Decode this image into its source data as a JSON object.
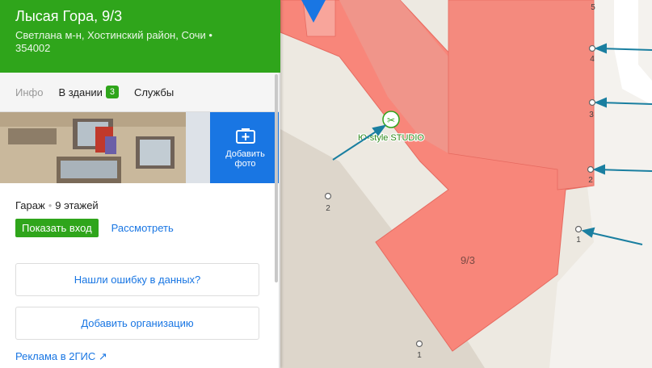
{
  "place": {
    "title": "Лысая Гора, 9/3",
    "address": "Светлана м-н, Хостинский район, Сочи • 354002"
  },
  "tabs": [
    {
      "label": "Инфо",
      "active": true
    },
    {
      "label": "В здании",
      "badge": "3"
    },
    {
      "label": "Службы"
    }
  ],
  "photos": {
    "add_label_line1": "Добавить",
    "add_label_line2": "фото"
  },
  "building": {
    "type": "Гараж",
    "floors": "9 этажей"
  },
  "actions": {
    "show_entrance": "Показать вход",
    "view": "Рассмотреть"
  },
  "buttons": {
    "report_error": "Нашли ошибку в данных?",
    "add_org": "Добавить организацию"
  },
  "ad_link": "Реклама в 2ГИС ↗",
  "map": {
    "building_label": "9/3",
    "org_label": "Ю-style STUDIO",
    "org_icon": "scissors-icon",
    "entrances_right": [
      "5",
      "4",
      "3",
      "2",
      "1"
    ],
    "entrances_other": [
      "2",
      "1"
    ],
    "colors": {
      "building": "#f8867a",
      "building_dark": "#f0746a",
      "accent": "#2fa51b",
      "arrow": "#1a7fa0"
    }
  }
}
